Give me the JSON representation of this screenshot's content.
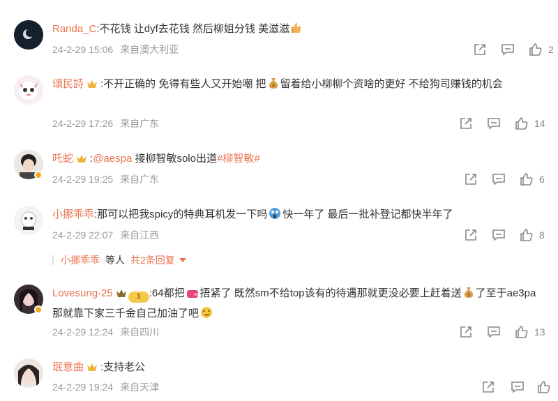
{
  "comments": [
    {
      "user": "Randa_C",
      "text": ":不花钱 让dyf去花钱 然后柳姐分钱 美滋滋",
      "time": "24-2-29 15:06",
      "location": "来自澳大利亚",
      "likes": "2"
    },
    {
      "user": "頌民詩",
      "text": ":不开正确的 免得有些人又开始嘲 把",
      "text2": "留着给小柳柳个资啥的更好 不给狗司赚钱的机会",
      "time": "24-2-29 17:26",
      "location": "来自广东",
      "likes": "14"
    },
    {
      "user": "吒蛇",
      "text_prefix": ":",
      "mention": "@aespa",
      "text": " 接柳智敏solo出道",
      "topic": "#柳智敏#",
      "time": "24-2-29 19:25",
      "location": "来自广东",
      "likes": "6"
    },
    {
      "user": "小挪乖乖",
      "text": ":那可以把我spicy的特典耳机发一下吗",
      "text2": "快一年了 最后一批补登记都快半年了",
      "time": "24-2-29 22:07",
      "location": "来自江西",
      "likes": "8",
      "replies": {
        "name": "小挪乖乖",
        "suffix": "等人",
        "more": "共2条回复"
      }
    },
    {
      "user": "Lovesung-25",
      "level": "1",
      "text": ":64都把",
      "text2": "捂紧了 既然sm不给top该有的待遇那就更没必要上赶着送",
      "text3": "了至于ae3pa那就靠下家三千金自己加油了吧",
      "time": "24-2-29 12:24",
      "location": "来自四川",
      "likes": "13"
    },
    {
      "user": "珉意曲",
      "text": ":支持老公",
      "time": "24-2-29 19:24",
      "location": "来自天津",
      "likes": ""
    }
  ],
  "icons": {
    "share": "share-icon",
    "comment": "comment-icon",
    "like": "thumbs-up-icon"
  },
  "colors": {
    "username": "#eb7350",
    "meta": "#999999",
    "icon": "#888888"
  }
}
